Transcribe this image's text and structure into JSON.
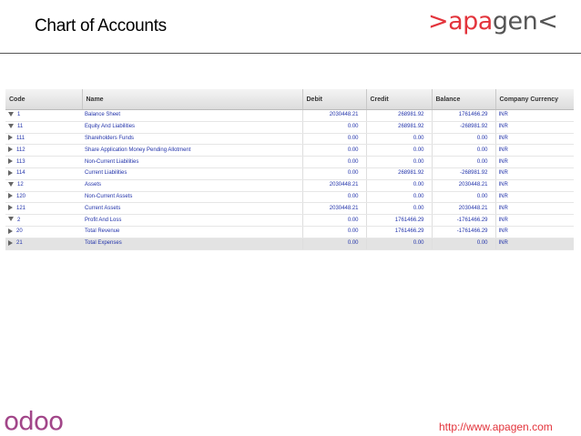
{
  "slide": {
    "title": "Chart of Accounts"
  },
  "logo": {
    "left": ">apa",
    "right": "gen<",
    "colors": {
      "accent": "#e3343c",
      "grey": "#555555"
    }
  },
  "table": {
    "columns": [
      "Code",
      "Name",
      "Debit",
      "Credit",
      "Balance",
      "Company Currency"
    ],
    "rows": [
      {
        "code": "1",
        "name": "Balance Sheet",
        "debit": "2030448.21",
        "credit": "268981.92",
        "balance": "1761466.29",
        "currency": "INR",
        "expander": "open",
        "level": 0
      },
      {
        "code": "11",
        "name": "Equity And Liabilities",
        "debit": "0.00",
        "credit": "268981.92",
        "balance": "-268981.92",
        "currency": "INR",
        "expander": "open",
        "level": 1
      },
      {
        "code": "111",
        "name": "Shareholders Funds",
        "debit": "0.00",
        "credit": "0.00",
        "balance": "0.00",
        "currency": "INR",
        "expander": "closed",
        "level": 2
      },
      {
        "code": "112",
        "name": "Share Application Money Pending Allotment",
        "debit": "0.00",
        "credit": "0.00",
        "balance": "0.00",
        "currency": "INR",
        "expander": "closed",
        "level": 2
      },
      {
        "code": "113",
        "name": "Non-Current Liabilities",
        "debit": "0.00",
        "credit": "0.00",
        "balance": "0.00",
        "currency": "INR",
        "expander": "closed",
        "level": 2
      },
      {
        "code": "114",
        "name": "Current Liabilities",
        "debit": "0.00",
        "credit": "268981.92",
        "balance": "-268981.92",
        "currency": "INR",
        "expander": "closed",
        "level": 2
      },
      {
        "code": "12",
        "name": "Assets",
        "debit": "2030448.21",
        "credit": "0.00",
        "balance": "2030448.21",
        "currency": "INR",
        "expander": "open",
        "level": 1
      },
      {
        "code": "120",
        "name": "Non-Current Assets",
        "debit": "0.00",
        "credit": "0.00",
        "balance": "0.00",
        "currency": "INR",
        "expander": "closed",
        "level": 2
      },
      {
        "code": "121",
        "name": "Current Assets",
        "debit": "2030448.21",
        "credit": "0.00",
        "balance": "2030448.21",
        "currency": "INR",
        "expander": "closed",
        "level": 2
      },
      {
        "code": "2",
        "name": "Profit And Loss",
        "debit": "0.00",
        "credit": "1761466.29",
        "balance": "-1761466.29",
        "currency": "INR",
        "expander": "open",
        "level": 0
      },
      {
        "code": "20",
        "name": "Total Revenue",
        "debit": "0.00",
        "credit": "1761466.29",
        "balance": "-1761466.29",
        "currency": "INR",
        "expander": "closed",
        "level": 1
      },
      {
        "code": "21",
        "name": "Total Expenses",
        "debit": "0.00",
        "credit": "0.00",
        "balance": "0.00",
        "currency": "INR",
        "expander": "closed",
        "level": 1,
        "selected": true
      }
    ]
  },
  "footer": {
    "odoo_logo": "odoo",
    "url": "http://www.apagen.com"
  }
}
